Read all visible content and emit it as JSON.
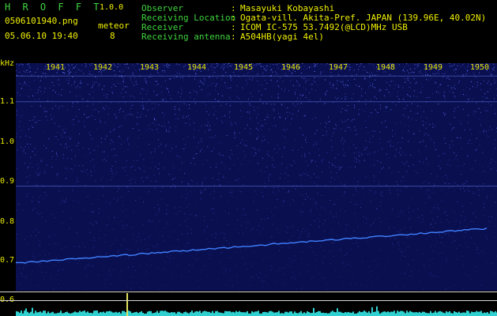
{
  "app": {
    "title": "H R O F F T",
    "version": "1.0.0",
    "filename": "0506101940.png",
    "mode_label": "meteor",
    "datetime": "05.06.10 19:40",
    "meteor_count": "8"
  },
  "info": {
    "labels": [
      "Observer",
      "Receiving Location",
      "Receiver",
      "Receiving antenna"
    ],
    "colon": ":",
    "values": [
      "Masayuki Kobayashi",
      "Ogata-vill. Akita-Pref. JAPAN (139.96E, 40.02N)",
      "ICOM IC-575 53.7492(@LCD)MHz USB",
      "A504HB(yagi 4el)"
    ]
  },
  "axis": {
    "unit": "kHz",
    "y_ticks": [
      "1.1",
      "1.0",
      "0.9",
      "0.8",
      "0.7",
      "0.6"
    ],
    "x_ticks": [
      "1941",
      "1942",
      "1943",
      "1944",
      "1945",
      "1946",
      "1947",
      "1948",
      "1949",
      "1950"
    ]
  },
  "colors": {
    "label_text": "#3fd43f",
    "value_text": "#f0f000",
    "background": "#000000",
    "noise_base": "#101878",
    "signal_line": "#4080ff",
    "level_meter": "#30d0d0"
  },
  "spectrogram": {
    "freq_range_khz": [
      0.58,
      1.2
    ],
    "time_range_hhmm": [
      1940,
      1950
    ],
    "carrier_trace_khz": {
      "start": 0.655,
      "end": 0.75
    },
    "steady_tone_khz": 0.865
  }
}
